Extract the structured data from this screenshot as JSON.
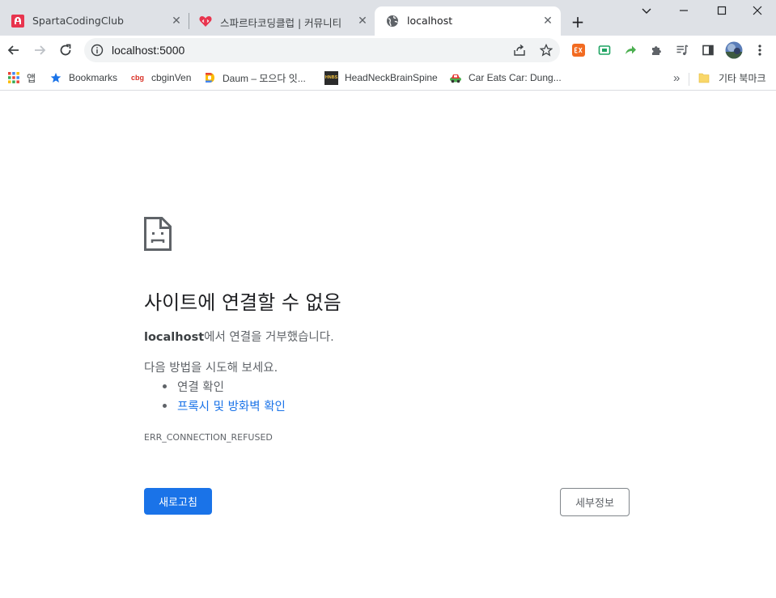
{
  "tabs": [
    {
      "title": "SpartaCodingClub",
      "icon": "sparta-logo-icon",
      "active": false
    },
    {
      "title": "스파르타코딩클럽 | 커뮤니티",
      "icon": "heart-code-icon",
      "active": false
    },
    {
      "title": "localhost",
      "icon": "globe-icon",
      "active": true
    }
  ],
  "toolbar": {
    "url": "localhost:5000"
  },
  "bookmarks": {
    "apps_label": "앱",
    "items": [
      {
        "label": "Bookmarks",
        "icon": "star-icon"
      },
      {
        "label": "cbginVen",
        "icon": "cbg-logo-icon",
        "icon_text": "cbg"
      },
      {
        "label": "Daum – 모으다 잇...",
        "icon": "daum-icon"
      },
      {
        "label": "HeadNeckBrainSpine",
        "icon": "hnbs-icon",
        "icon_text": "HNBS"
      },
      {
        "label": "Car Eats Car: Dung...",
        "icon": "car-icon"
      }
    ],
    "overflow": "»",
    "other_label": "기타 북마크"
  },
  "error": {
    "heading": "사이트에 연결할 수 없음",
    "host": "localhost",
    "message": "에서 연결을 거부했습니다.",
    "suggest_intro": "다음 방법을 시도해 보세요.",
    "suggestions": [
      "연결 확인",
      "프록시 및 방화벽 확인"
    ],
    "code": "ERR_CONNECTION_REFUSED",
    "reload_label": "새로고침",
    "details_label": "세부정보"
  },
  "colors": {
    "accent": "#1a73e8",
    "tabstrip": "#dee1e6",
    "text_secondary": "#5f6368"
  }
}
